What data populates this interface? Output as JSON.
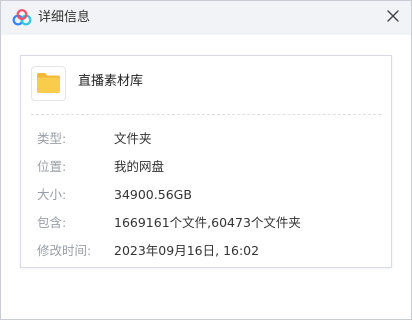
{
  "window": {
    "title": "详细信息",
    "icons": {
      "app": "baidu-netdisk-cloud-icon",
      "close": "close-icon",
      "folder": "folder-icon"
    }
  },
  "file": {
    "name": "直播素材库"
  },
  "details": [
    {
      "label": "类型:",
      "value": "文件夹"
    },
    {
      "label": "位置:",
      "value": "我的网盘"
    },
    {
      "label": "大小:",
      "value": "34900.56GB"
    },
    {
      "label": "包含:",
      "value": "1669161个文件,60473个文件夹"
    },
    {
      "label": "修改时间:",
      "value": "2023年09月16日, 16:02"
    }
  ],
  "colors": {
    "titlebar_bg": "#f2f3f6",
    "folder_yellow": "#f9cc4b",
    "label_gray": "#9a9ea6",
    "value_dark": "#333333",
    "logo_blue": "#2f86f6",
    "logo_pink": "#ef4f6a",
    "logo_cyan": "#34c6e0"
  }
}
